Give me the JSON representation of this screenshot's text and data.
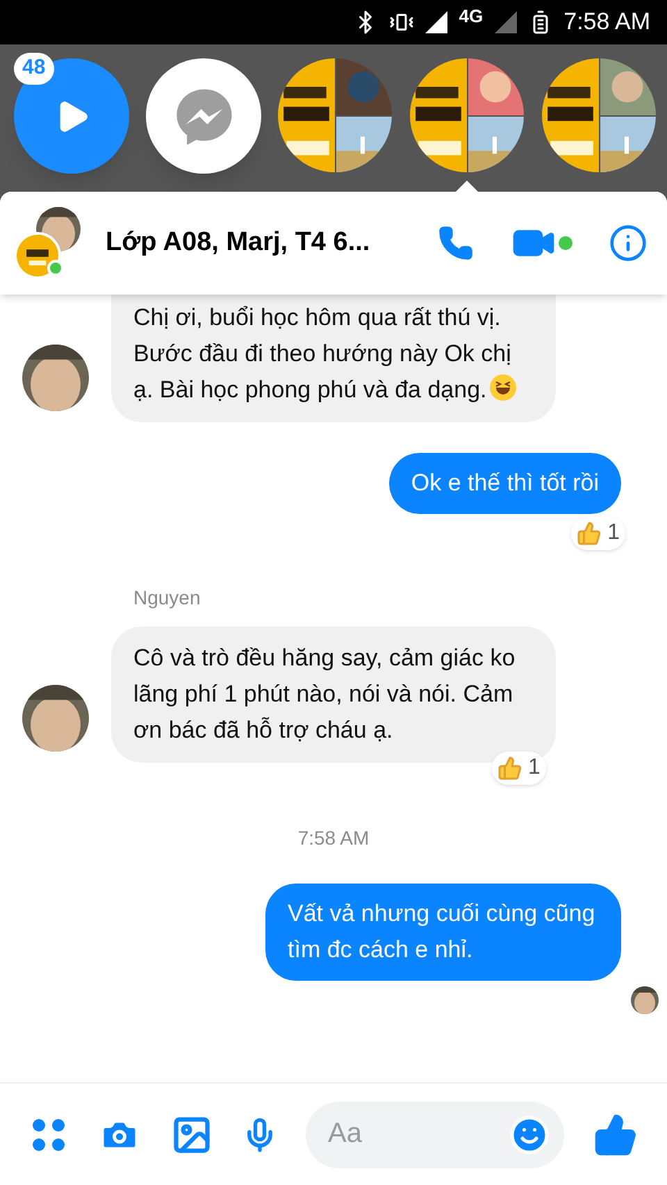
{
  "status_bar": {
    "network": "4G",
    "time": "7:58 AM"
  },
  "chat_heads": [
    {
      "kind": "play",
      "badge": "48",
      "selected": false
    },
    {
      "kind": "messenger",
      "selected": false
    },
    {
      "kind": "group",
      "selected": false
    },
    {
      "kind": "group",
      "selected": true
    },
    {
      "kind": "group",
      "selected": false
    }
  ],
  "header": {
    "title": "Lớp A08, Marj, T4 6...",
    "online": true,
    "video_active": true
  },
  "messages": [
    {
      "kind": "incoming",
      "text": "Chị ơi, buổi học hôm qua rất thú vị. Bước đầu đi theo hướng này Ok chị ạ. Bài học phong phú và đa dạng.",
      "emoji": true
    },
    {
      "kind": "outgoing",
      "text": "Ok e thế thì tốt rồi",
      "reaction": "1"
    },
    {
      "kind": "sender",
      "text": "Nguyen"
    },
    {
      "kind": "incoming",
      "text": "Cô và trò đều hăng say, cảm giác ko lãng phí 1 phút nào, nói và nói. Cảm ơn bác đã hỗ trợ cháu ạ.",
      "reaction": "1"
    },
    {
      "kind": "time",
      "text": "7:58 AM"
    },
    {
      "kind": "outgoing",
      "text": "Vất vả nhưng cuối cùng cũng tìm đc cách e nhỉ.",
      "seen": true
    }
  ],
  "composer": {
    "placeholder": "Aa"
  }
}
